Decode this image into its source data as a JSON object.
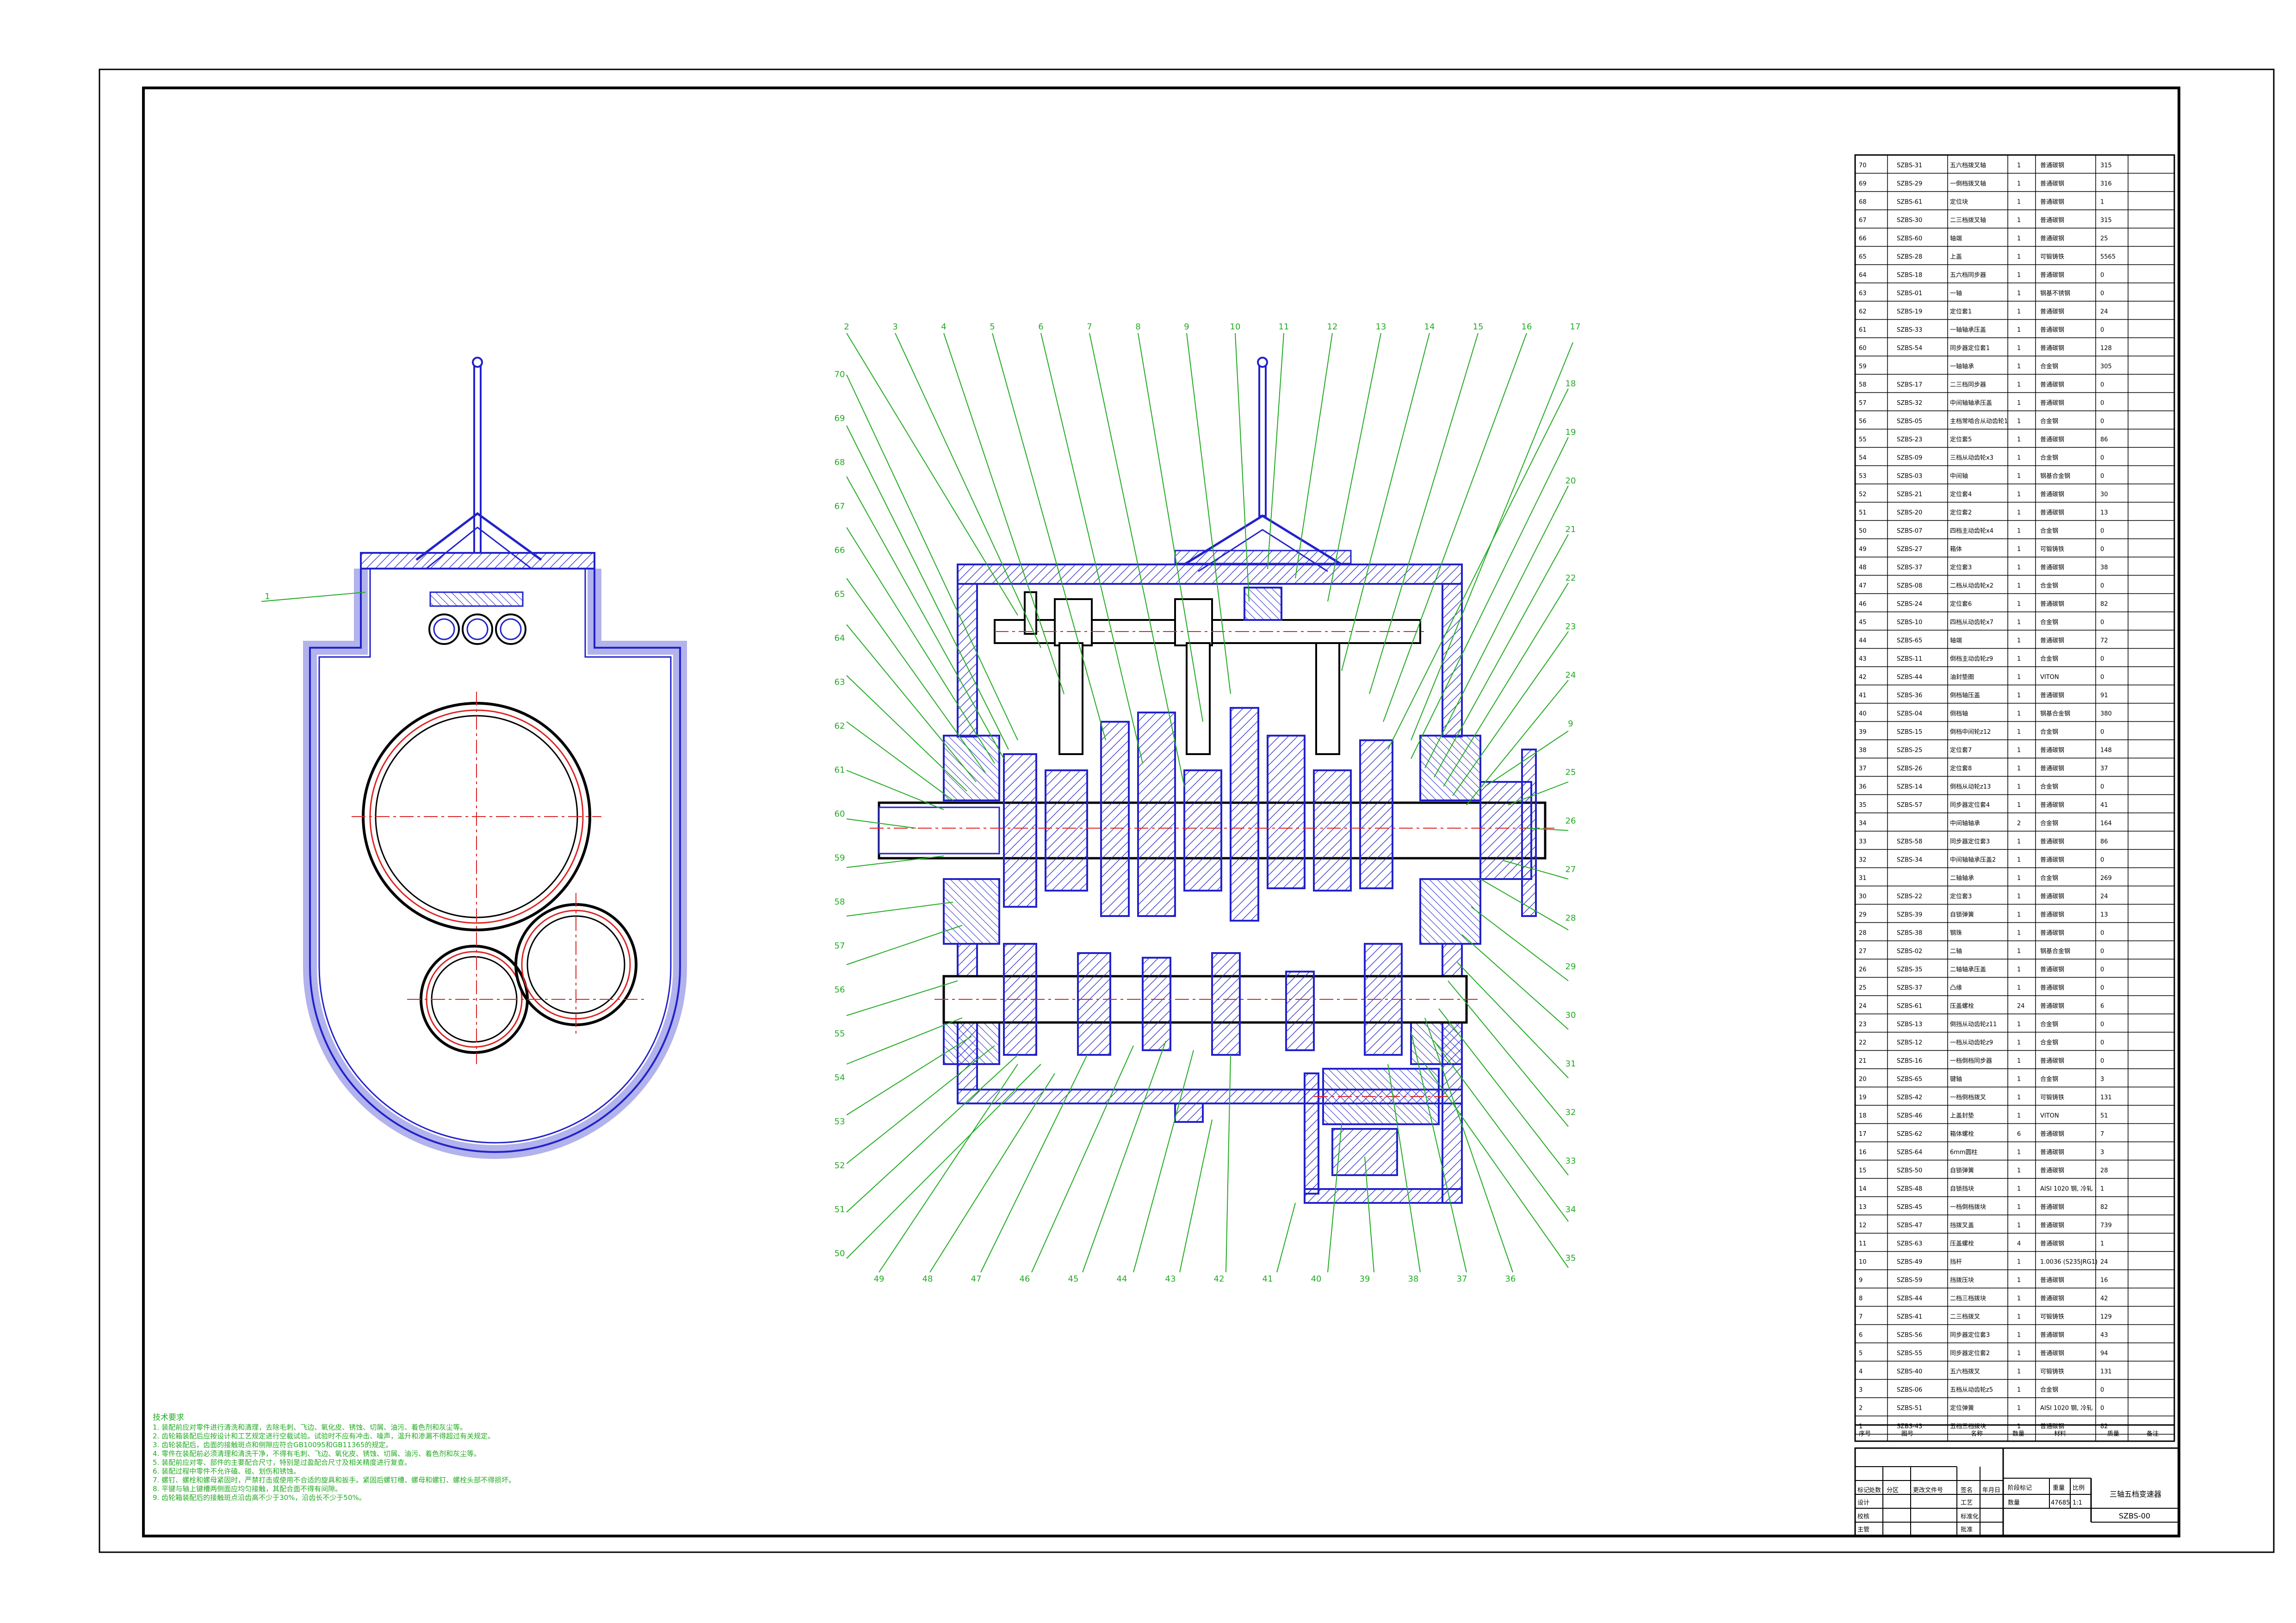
{
  "sheet": {
    "title": "三轴五档变速器",
    "drawing_number": "SZBS-00",
    "scale": "1:1",
    "weight": "47685",
    "labels": {
      "stage_mark": "阶段标记",
      "weight": "重量",
      "scale": "比例",
      "quantity": "数量",
      "mark": "标记",
      "count": "处数",
      "zone": "分区",
      "change_doc": "更改文件号",
      "signature": "签名",
      "date": "年月日",
      "design": "设计",
      "review": "校核",
      "supervisor": "主管",
      "process": "工艺",
      "standard": "标准化",
      "approve": "批准"
    }
  },
  "bom_header": {
    "seq": "序号",
    "code": "图号",
    "name": "名称",
    "qty": "数量",
    "material": "材料",
    "weight": "质量",
    "remark": "备注"
  },
  "bom": [
    [
      "70",
      "SZBS-31",
      "五六档拨叉轴",
      "1",
      "普通碳钢",
      "315"
    ],
    [
      "69",
      "SZBS-29",
      "一倒档拨叉轴",
      "1",
      "普通碳钢",
      "316"
    ],
    [
      "68",
      "SZBS-61",
      "定位块",
      "1",
      "普通碳钢",
      "1"
    ],
    [
      "67",
      "SZBS-30",
      "二三档拨叉轴",
      "1",
      "普通碳钢",
      "315"
    ],
    [
      "66",
      "SZBS-60",
      "轴端",
      "1",
      "普通碳钢",
      "25"
    ],
    [
      "65",
      "SZBS-28",
      "上盖",
      "1",
      "可锻铸铁",
      "5565"
    ],
    [
      "64",
      "SZBS-18",
      "五六档同步器",
      "1",
      "普通碳钢",
      "0"
    ],
    [
      "63",
      "SZBS-01",
      "一轴",
      "1",
      "钢基不锈钢",
      "0"
    ],
    [
      "62",
      "SZBS-19",
      "定位套1",
      "1",
      "普通碳钢",
      "24"
    ],
    [
      "61",
      "SZBS-33",
      "一轴轴承压盖",
      "1",
      "普通碳钢",
      "0"
    ],
    [
      "60",
      "SZBS-54",
      "同步器定位套1",
      "1",
      "普通碳钢",
      "128"
    ],
    [
      "59",
      "",
      "一轴轴承",
      "1",
      "合金钢",
      "305"
    ],
    [
      "58",
      "SZBS-17",
      "二三档同步器",
      "1",
      "普通碳钢",
      "0"
    ],
    [
      "57",
      "SZBS-32",
      "中间轴轴承压盖",
      "1",
      "普通碳钢",
      "0"
    ],
    [
      "56",
      "SZBS-05",
      "主档常啮合从动齿轮1",
      "1",
      "合金钢",
      "0"
    ],
    [
      "55",
      "SZBS-23",
      "定位套5",
      "1",
      "普通碳钢",
      "86"
    ],
    [
      "54",
      "SZBS-09",
      "三档从动齿轮x3",
      "1",
      "合金钢",
      "0"
    ],
    [
      "53",
      "SZBS-03",
      "中间轴",
      "1",
      "钢基合金钢",
      "0"
    ],
    [
      "52",
      "SZBS-21",
      "定位套4",
      "1",
      "普通碳钢",
      "30"
    ],
    [
      "51",
      "SZBS-20",
      "定位套2",
      "1",
      "普通碳钢",
      "13"
    ],
    [
      "50",
      "SZBS-07",
      "四档主动齿轮x4",
      "1",
      "合金钢",
      "0"
    ],
    [
      "49",
      "SZBS-27",
      "箱体",
      "1",
      "可锻铸铁",
      "0"
    ],
    [
      "48",
      "SZBS-37",
      "定位套3",
      "1",
      "普通碳钢",
      "38"
    ],
    [
      "47",
      "SZBS-08",
      "二档从动齿轮x2",
      "1",
      "合金钢",
      "0"
    ],
    [
      "46",
      "SZBS-24",
      "定位套6",
      "1",
      "普通碳钢",
      "82"
    ],
    [
      "45",
      "SZBS-10",
      "四档从动齿轮x7",
      "1",
      "合金钢",
      "0"
    ],
    [
      "44",
      "SZBS-65",
      "轴端",
      "1",
      "普通碳钢",
      "72"
    ],
    [
      "43",
      "SZBS-11",
      "倒档主动齿轮z9",
      "1",
      "合金钢",
      "0"
    ],
    [
      "42",
      "SZBS-44",
      "油封垫圈",
      "1",
      "VITON",
      "0"
    ],
    [
      "41",
      "SZBS-36",
      "倒档轴压盖",
      "1",
      "普通碳钢",
      "91"
    ],
    [
      "40",
      "SZBS-04",
      "倒档轴",
      "1",
      "钢基合金钢",
      "380"
    ],
    [
      "39",
      "SZBS-15",
      "倒档中间轮z12",
      "1",
      "合金钢",
      "0"
    ],
    [
      "38",
      "SZBS-25",
      "定位套7",
      "1",
      "普通碳钢",
      "148"
    ],
    [
      "37",
      "SZBS-26",
      "定位套8",
      "1",
      "普通碳钢",
      "37"
    ],
    [
      "36",
      "SZBS-14",
      "倒档从动轮z13",
      "1",
      "合金钢",
      "0"
    ],
    [
      "35",
      "SZBS-57",
      "同步器定位套4",
      "1",
      "普通碳钢",
      "41"
    ],
    [
      "34",
      "",
      "中间轴轴承",
      "2",
      "合金钢",
      "164"
    ],
    [
      "33",
      "SZBS-58",
      "同步器定位套3",
      "1",
      "普通碳钢",
      "86"
    ],
    [
      "32",
      "SZBS-34",
      "中间轴轴承压盖2",
      "1",
      "普通碳钢",
      "0"
    ],
    [
      "31",
      "",
      "二轴轴承",
      "1",
      "合金钢",
      "269"
    ],
    [
      "30",
      "SZBS-22",
      "定位套3",
      "1",
      "普通碳钢",
      "24"
    ],
    [
      "29",
      "SZBS-39",
      "自锁弹簧",
      "1",
      "普通碳钢",
      "13"
    ],
    [
      "28",
      "SZBS-38",
      "钢珠",
      "1",
      "普通碳钢",
      "0"
    ],
    [
      "27",
      "SZBS-02",
      "二轴",
      "1",
      "钢基合金钢",
      "0"
    ],
    [
      "26",
      "SZBS-35",
      "二轴轴承压盖",
      "1",
      "普通碳钢",
      "0"
    ],
    [
      "25",
      "SZBS-37",
      "凸缘",
      "1",
      "普通碳钢",
      "0"
    ],
    [
      "24",
      "SZBS-61",
      "压盖螺栓",
      "24",
      "普通碳钢",
      "6"
    ],
    [
      "23",
      "SZBS-13",
      "倒挡从动齿轮z11",
      "1",
      "合金钢",
      "0"
    ],
    [
      "22",
      "SZBS-12",
      "一档从动齿轮z9",
      "1",
      "合金钢",
      "0"
    ],
    [
      "21",
      "SZBS-16",
      "一档倒档同步器",
      "1",
      "普通碳钢",
      "0"
    ],
    [
      "20",
      "SZBS-65",
      "键轴",
      "1",
      "合金钢",
      "3"
    ],
    [
      "19",
      "SZBS-42",
      "一档倒档拨叉",
      "1",
      "可锻铸铁",
      "131"
    ],
    [
      "18",
      "SZBS-46",
      "上盖封垫",
      "1",
      "VITON",
      "51"
    ],
    [
      "17",
      "SZBS-62",
      "箱体螺栓",
      "6",
      "普通碳钢",
      "7"
    ],
    [
      "16",
      "SZBS-64",
      "6mm圆柱",
      "1",
      "普通碳钢",
      "3"
    ],
    [
      "15",
      "SZBS-50",
      "自锁弹簧",
      "1",
      "普通碳钢",
      "28"
    ],
    [
      "14",
      "SZBS-48",
      "自锁挡块",
      "1",
      "AISI 1020 钢, 冷轧",
      "1"
    ],
    [
      "13",
      "SZBS-45",
      "一档倒档拨块",
      "1",
      "普通碳钢",
      "82"
    ],
    [
      "12",
      "SZBS-47",
      "挡拨叉盖",
      "1",
      "普通碳钢",
      "739"
    ],
    [
      "11",
      "SZBS-63",
      "压盖螺栓",
      "4",
      "普通碳钢",
      "1"
    ],
    [
      "10",
      "SZBS-49",
      "挡杆",
      "1",
      "1.0036 (S235JRG1)",
      "24"
    ],
    [
      "9",
      "SZBS-59",
      "挡拨压块",
      "1",
      "普通碳钢",
      "16"
    ],
    [
      "8",
      "SZBS-44",
      "二档三档拨块",
      "1",
      "普通碳钢",
      "42"
    ],
    [
      "7",
      "SZBS-41",
      "二三档拨叉",
      "1",
      "可锻铸铁",
      "129"
    ],
    [
      "6",
      "SZBS-56",
      "同步器定位套3",
      "1",
      "普通碳钢",
      "43"
    ],
    [
      "5",
      "SZBS-55",
      "同步器定位套2",
      "1",
      "普通碳钢",
      "94"
    ],
    [
      "4",
      "SZBS-40",
      "五六档拨叉",
      "1",
      "可锻铸铁",
      "131"
    ],
    [
      "3",
      "SZBS-06",
      "五档从动齿轮z5",
      "1",
      "合金钢",
      "0"
    ],
    [
      "2",
      "SZBS-51",
      "定位弹簧",
      "1",
      "AISI 1020 钢, 冷轧",
      "0"
    ],
    [
      "1",
      "SZBS-43",
      "五档三档拨块",
      "1",
      "普通碳钢",
      "82"
    ]
  ],
  "notes": {
    "title": "技术要求",
    "items": [
      "1. 装配前应对零件进行清洗和清理，去除毛刺、飞边、氧化皮、锈蚀、切屑、油污、着色剂和灰尘等。",
      "2. 齿轮箱装配后应按设计和工艺规定进行空载试验。试验时不应有冲击、噪声，温升和渗漏不得超过有关规定。",
      "3. 齿轮装配后，齿面的接触斑点和侧隙应符合GB10095和GB11365的规定。",
      "4. 零件在装配前必须清理和清洗干净，不得有毛刺、飞边、氧化皮、锈蚀、切屑、油污、着色剂和灰尘等。",
      "5. 装配前应对零、部件的主要配合尺寸，特别是过盈配合尺寸及相关精度进行复查。",
      "6. 装配过程中零件不允许磕、碰、划伤和锈蚀。",
      "7. 螺钉、螺栓和螺母紧固时，严禁打击或使用不合适的旋具和扳手。紧固后螺钉槽、螺母和螺钉、螺栓头部不得损坏。",
      "8. 平键与轴上键槽两侧面应均匀接触，其配合面不得有间隙。",
      "9. 齿轮箱装配后的接触斑点沿齿高不少于30%，沿齿长不少于50%。"
    ]
  },
  "balloons": {
    "top": [
      "2",
      "3",
      "4",
      "5",
      "6",
      "7",
      "8",
      "9",
      "10",
      "11",
      "12",
      "13",
      "14",
      "15",
      "16",
      "17"
    ],
    "right": [
      "18",
      "19",
      "20",
      "21",
      "22",
      "23",
      "24",
      "9",
      "25",
      "26",
      "27",
      "28",
      "29",
      "30",
      "31",
      "32",
      "33",
      "34",
      "35"
    ],
    "bottom": [
      "49",
      "48",
      "47",
      "46",
      "45",
      "44",
      "43",
      "42",
      "41",
      "40",
      "39",
      "38",
      "37",
      "36"
    ],
    "left": [
      "70",
      "69",
      "68",
      "67",
      "66",
      "65",
      "64",
      "63",
      "62",
      "61",
      "60",
      "59",
      "58",
      "57",
      "56",
      "55",
      "54",
      "53",
      "52",
      "51",
      "50"
    ],
    "section": [
      "1"
    ]
  },
  "colors": {
    "outline": "#000000",
    "section_body": "#2222cc",
    "center_line": "#dd2222",
    "leader": "#22aa22",
    "hatch": "#2222cc"
  }
}
